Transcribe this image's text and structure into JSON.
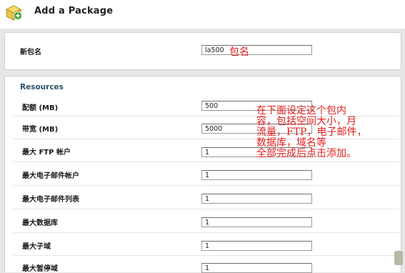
{
  "header": {
    "title": "Add a Package",
    "icon": "package-add-icon",
    "icon_colors": {
      "box": "#e8c544",
      "plus": "#3a9e2e"
    }
  },
  "name_panel": {
    "label": "新包名",
    "value": "la500",
    "annotation": "包名"
  },
  "resources": {
    "title": "Resources",
    "rows": [
      {
        "label": "配额 (MB)",
        "value": "500"
      },
      {
        "label": "带宽 (MB)",
        "value": "5000"
      },
      {
        "label": "最大 FTP 帐户",
        "value": "1"
      },
      {
        "label": "最大电子邮件帐户",
        "value": "1"
      },
      {
        "label": "最大电子邮件列表",
        "value": "1"
      },
      {
        "label": "最大数据库",
        "value": "1"
      },
      {
        "label": "最大子域",
        "value": "1"
      },
      {
        "label": "最大暂停域",
        "value": "1"
      }
    ],
    "note_lines": [
      "在下面设定这个包内",
      "容，包括空间大小，月",
      "流量，FTP，电子邮件，",
      "数据库，域名等",
      "全部完成后点击添加。"
    ]
  },
  "colors": {
    "page_bg": "#e6e6e6",
    "section_title": "#2e5169",
    "annotation": "#e21f1f"
  }
}
